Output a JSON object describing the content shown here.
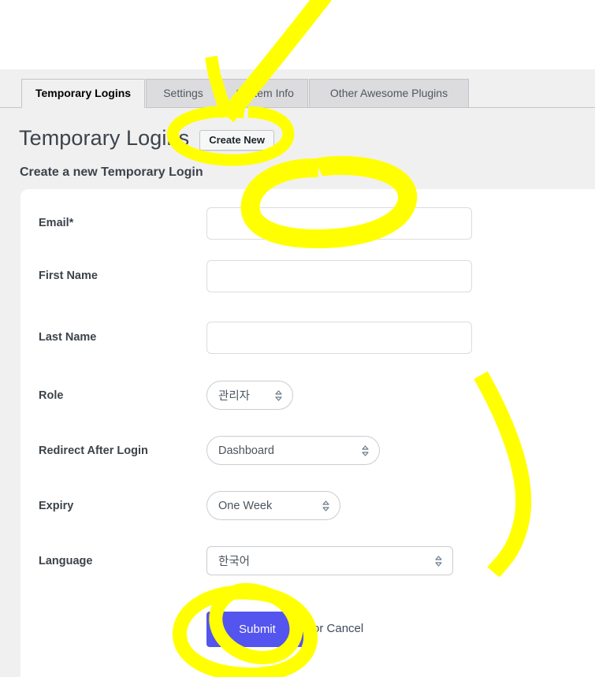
{
  "window": {
    "background_top": "#ffffff",
    "admin_background": "#f0f0f1"
  },
  "tabs": [
    {
      "label": "Temporary Logins",
      "active": true
    },
    {
      "label": "Settings",
      "active": false
    },
    {
      "label": "System Info",
      "active": false
    },
    {
      "label": "Other Awesome Plugins",
      "active": false
    }
  ],
  "header": {
    "page_title": "Temporary Logins",
    "create_new_label": "Create New",
    "section_subtitle": "Create a new Temporary Login"
  },
  "form": {
    "fields": [
      {
        "label": "Email*",
        "type": "text",
        "value": "",
        "placeholder": ""
      },
      {
        "label": "First Name",
        "type": "text",
        "value": "",
        "placeholder": ""
      },
      {
        "label": "Last Name",
        "type": "text",
        "value": "",
        "placeholder": ""
      },
      {
        "label": "Role",
        "type": "select",
        "value": "관리자"
      },
      {
        "label": "Redirect After Login",
        "type": "select",
        "value": "Dashboard"
      },
      {
        "label": "Expiry",
        "type": "select",
        "value": "One Week"
      },
      {
        "label": "Language",
        "type": "select",
        "value": "한국어"
      }
    ],
    "submit_label": "Submit",
    "cancel_prefix": "or ",
    "cancel_label": "Cancel",
    "submit_color": "#5454ef"
  },
  "icons": {
    "select_spinner": "up-down-spinner-icon"
  },
  "annotations": {
    "ink_color": "#ffff00",
    "marks": [
      {
        "name": "arrow-to-create-new",
        "shape": "arrow"
      },
      {
        "name": "ellipse-around-create-new",
        "shape": "ellipse"
      },
      {
        "name": "ellipse-around-email-input",
        "shape": "ellipse"
      },
      {
        "name": "brace-right-of-selects",
        "shape": "curve"
      },
      {
        "name": "ellipse-around-submit-outer",
        "shape": "ellipse"
      },
      {
        "name": "ellipse-around-submit-inner",
        "shape": "ellipse"
      }
    ]
  }
}
